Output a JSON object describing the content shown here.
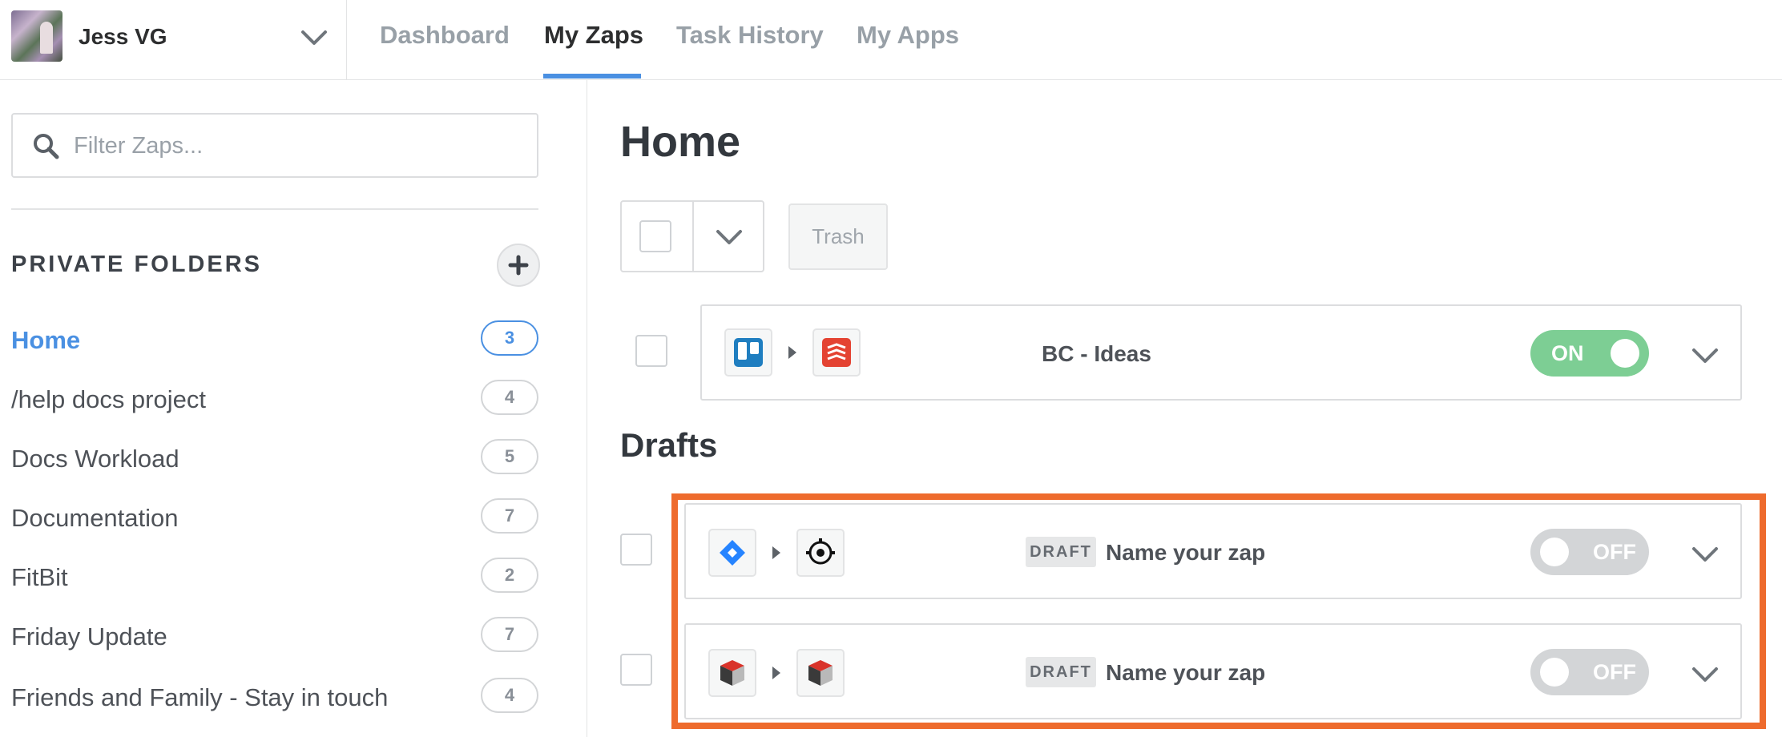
{
  "account": {
    "name": "Jess VG"
  },
  "nav": {
    "tabs": [
      "Dashboard",
      "My Zaps",
      "Task History",
      "My Apps"
    ],
    "active": "My Zaps"
  },
  "filter": {
    "placeholder": "Filter Zaps..."
  },
  "sidebar": {
    "section_title": "PRIVATE FOLDERS",
    "folders": [
      {
        "name": "Home",
        "count": "3",
        "active": true
      },
      {
        "name": "/help docs project",
        "count": "4"
      },
      {
        "name": "Docs Workload",
        "count": "5"
      },
      {
        "name": "Documentation",
        "count": "7"
      },
      {
        "name": "FitBit",
        "count": "2"
      },
      {
        "name": "Friday Update",
        "count": "7"
      },
      {
        "name": "Friends and Family - Stay in touch",
        "count": "4"
      }
    ]
  },
  "main": {
    "title": "Home",
    "trash_label": "Trash",
    "zaps": [
      {
        "name": "BC - Ideas",
        "status": "ON",
        "trigger_icon": "trello-icon",
        "action_icon": "todoist-icon"
      }
    ],
    "drafts_title": "Drafts",
    "drafts": [
      {
        "badge": "DRAFT",
        "name": "Name your zap",
        "status": "OFF",
        "trigger_icon": "jira-icon",
        "action_icon": "gear-circle-icon"
      },
      {
        "badge": "DRAFT",
        "name": "Name your zap",
        "status": "OFF",
        "trigger_icon": "cube-icon",
        "action_icon": "cube-icon"
      }
    ]
  },
  "colors": {
    "accent": "#4a90e2",
    "toggle_on": "#7dce94",
    "toggle_off": "#d3d5d7",
    "highlight": "#ee6b2d"
  }
}
